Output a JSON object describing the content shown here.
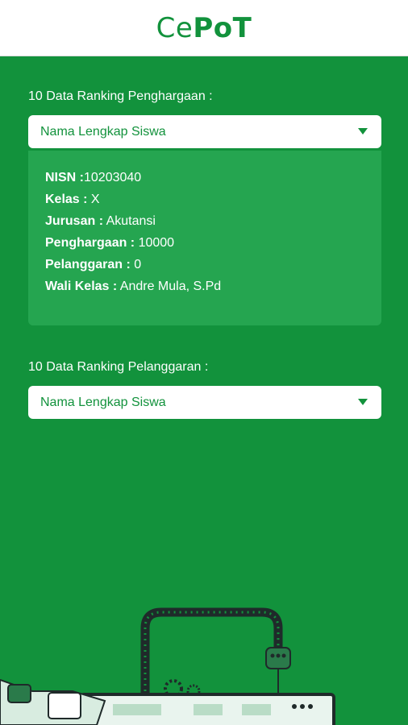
{
  "app": {
    "logo_light": "Ce",
    "logo_bold": "PoT",
    "brand_color": "#12923c"
  },
  "rewards": {
    "label": "10 Data Ranking Penghargaan :",
    "dropdown_value": "Nama Lengkap Siswa",
    "details": [
      {
        "key": "NISN :",
        "value": "10203040"
      },
      {
        "key": "Kelas :",
        "value": " X"
      },
      {
        "key": "Jurusan :",
        "value": " Akutansi"
      },
      {
        "key": "Penghargaan :",
        "value": " 10000"
      },
      {
        "key": "Pelanggaran :",
        "value": " 0"
      },
      {
        "key": "Wali Kelas :",
        "value": " Andre Mula, S.Pd"
      }
    ]
  },
  "violations": {
    "label": "10 Data Ranking Pelanggaran :",
    "dropdown_value": "Nama Lengkap Siswa"
  },
  "icons": {
    "dropdown_caret": "chevron-down-icon",
    "illustration": "computer-cable-illustration"
  }
}
